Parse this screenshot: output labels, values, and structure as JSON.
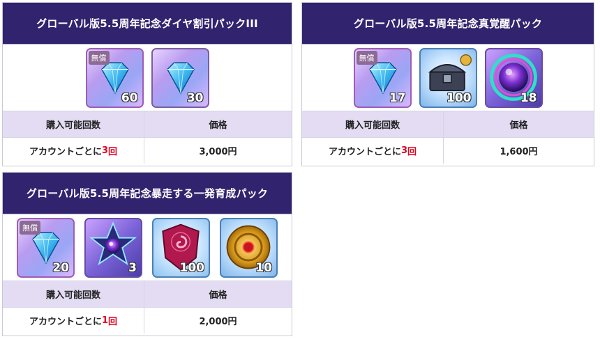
{
  "labels": {
    "free": "無償",
    "purchase_limit_header": "購入可能回数",
    "price_header": "価格",
    "per_account": "アカウントごとに",
    "times_suffix": "回"
  },
  "packs": [
    {
      "title": "グローバル版5.5周年記念ダイヤ割引パックIII",
      "items": [
        {
          "icon": "diamond-icon",
          "count": "60",
          "free": true
        },
        {
          "icon": "diamond-icon",
          "count": "30",
          "free": false
        }
      ],
      "limit_count": "3",
      "price": "3,000円"
    },
    {
      "title": "グローバル版5.5周年記念真覚醒パック",
      "items": [
        {
          "icon": "diamond-icon",
          "count": "17",
          "free": true
        },
        {
          "icon": "treasure-chest-icon",
          "count": "100",
          "free": false
        },
        {
          "icon": "awakening-orb-icon",
          "count": "18",
          "free": false
        }
      ],
      "limit_count": "3",
      "price": "1,600円"
    },
    {
      "title": "グローバル版5.5周年記念暴走する一発育成パック",
      "items": [
        {
          "icon": "diamond-icon",
          "count": "20",
          "free": true
        },
        {
          "icon": "star-crystal-icon",
          "count": "3",
          "free": false
        },
        {
          "icon": "crimson-shield-icon",
          "count": "100",
          "free": false
        },
        {
          "icon": "gold-seal-icon",
          "count": "10",
          "free": false
        }
      ],
      "limit_count": "1",
      "price": "2,000円"
    }
  ]
}
